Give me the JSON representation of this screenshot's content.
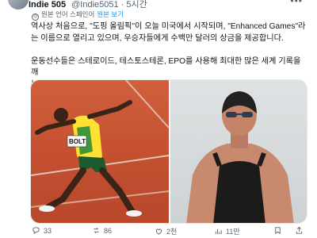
{
  "author": {
    "display_name": "Indie 505",
    "handle": "@Indie5051 · 5시간",
    "more_icon": "more-icon"
  },
  "translation": {
    "icon": "translate-icon",
    "original_label": "원본 언어 스페인어",
    "view_original_link": "원본 보기"
  },
  "tweet": {
    "text": "역사상 처음으로, \"도핑 올림픽\"이 오늘 미국에서 시작되며, \"Enhanced Games\"라\n는 이름으로 열리고 있으며, 우승자들에게 수백만 달러의 상금을 제공합니다.\n\n운동선수들은 스테로이드, 테스토스테론, EPO를 사용해 최대한 많은 세계 기록을 깨\n는 것이 허용됩니다..."
  },
  "media": {
    "left_photo_bib": "BOLT"
  },
  "actions": {
    "reply_count": "33",
    "repost_count": "86",
    "like_count": "2천",
    "views_count": "11만",
    "icons": [
      "reply-icon",
      "repost-icon",
      "like-icon",
      "views-icon",
      "bookmark-icon",
      "share-icon"
    ]
  }
}
